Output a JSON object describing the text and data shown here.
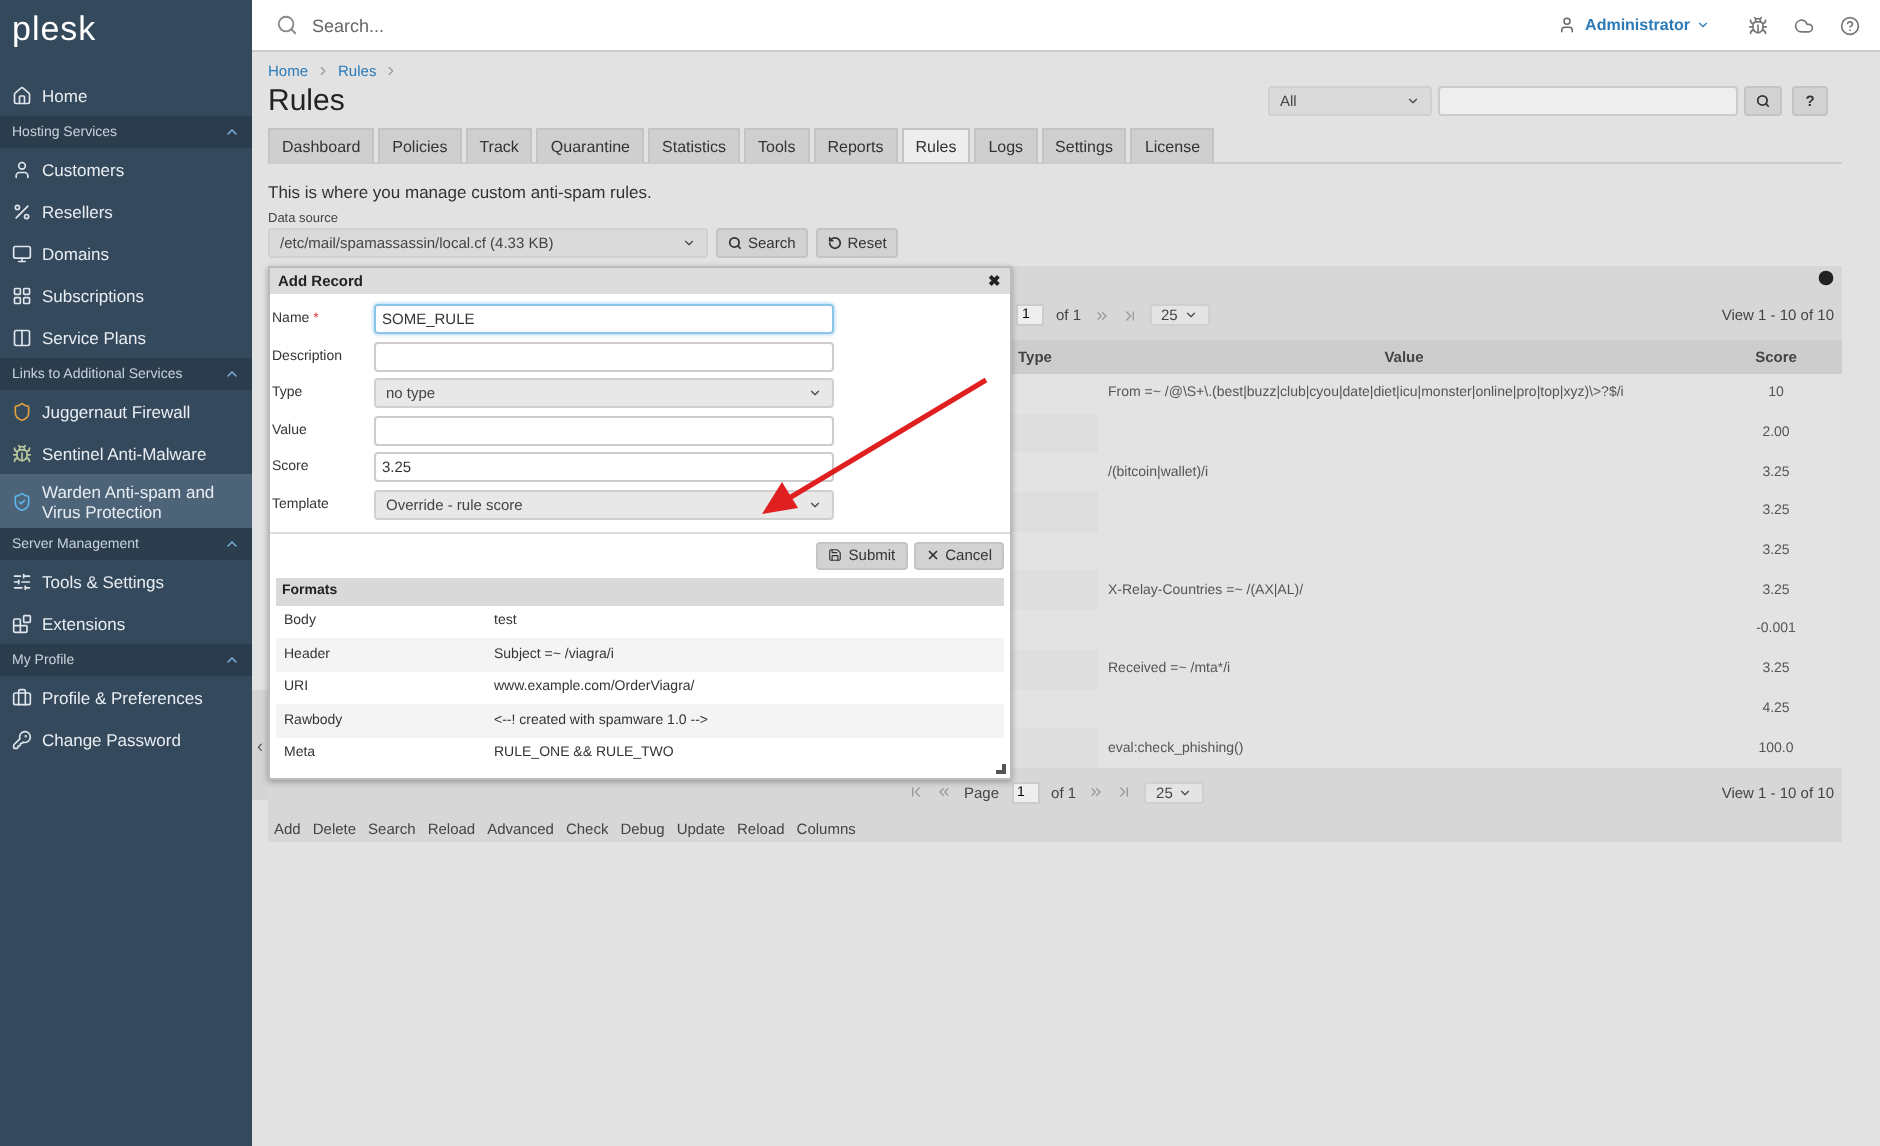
{
  "sidebar": {
    "logo": "plesk",
    "items": [
      {
        "kind": "item",
        "label": "Home",
        "selected": false
      },
      {
        "kind": "section",
        "label": "Hosting Services",
        "expanded": true
      },
      {
        "kind": "item",
        "label": "Customers",
        "selected": false
      },
      {
        "kind": "item",
        "label": "Resellers",
        "selected": false
      },
      {
        "kind": "item",
        "label": "Domains",
        "selected": false
      },
      {
        "kind": "item",
        "label": "Subscriptions",
        "selected": false
      },
      {
        "kind": "item",
        "label": "Service Plans",
        "selected": false
      },
      {
        "kind": "section",
        "label": "Links to Additional Services",
        "expanded": true
      },
      {
        "kind": "item",
        "label": "Juggernaut Firewall",
        "selected": false
      },
      {
        "kind": "item",
        "label": "Sentinel Anti-Malware",
        "selected": false
      },
      {
        "kind": "item",
        "label": "Warden Anti-spam and Virus Protection",
        "selected": true
      },
      {
        "kind": "section",
        "label": "Server Management",
        "expanded": true
      },
      {
        "kind": "item",
        "label": "Tools & Settings",
        "selected": false
      },
      {
        "kind": "item",
        "label": "Extensions",
        "selected": false
      },
      {
        "kind": "section",
        "label": "My Profile",
        "expanded": true
      },
      {
        "kind": "item",
        "label": "Profile & Preferences",
        "selected": false
      },
      {
        "kind": "item",
        "label": "Change Password",
        "selected": false
      }
    ],
    "collapse": "‹"
  },
  "topbar": {
    "search": {
      "placeholder": "Search..."
    },
    "user": "Administrator"
  },
  "breadcrumbs": [
    "Home",
    "Rules"
  ],
  "title": "Rules",
  "filter": {
    "scope": "All",
    "help": "?"
  },
  "tabs": [
    {
      "label": "Dashboard",
      "selected": false
    },
    {
      "label": "Policies",
      "selected": false
    },
    {
      "label": "Track",
      "selected": false
    },
    {
      "label": "Quarantine",
      "selected": false
    },
    {
      "label": "Statistics",
      "selected": false
    },
    {
      "label": "Tools",
      "selected": false
    },
    {
      "label": "Reports",
      "selected": false
    },
    {
      "label": "Rules",
      "selected": true
    },
    {
      "label": "Logs",
      "selected": false
    },
    {
      "label": "Settings",
      "selected": false
    },
    {
      "label": "License",
      "selected": false
    }
  ],
  "description": "This is where you manage custom anti-spam rules.",
  "data_source": {
    "label": "Data source",
    "value": "/etc/mail/spamassassin/local.cf (4.33 KB)",
    "buttons": [
      "Search",
      "Reset"
    ]
  },
  "grid": {
    "pager_top": {
      "page": "1",
      "of": "of 1",
      "page_size": "25",
      "view": "View 1 - 10 of 10"
    },
    "columns": [
      "Type",
      "Value",
      "Score"
    ],
    "rows": [
      {
        "value": "From =~ /@\\S+\\.(best|buzz|club|cyou|date|diet|icu|monster|online|pro|top|xyz)\\>?$/i",
        "score": "10"
      },
      {
        "score": "2.00"
      },
      {
        "value": "/(bitcoin|wallet)/i",
        "score": "3.25"
      },
      {
        "score": "3.25"
      },
      {
        "score": "3.25"
      },
      {
        "value": "X-Relay-Countries =~ /(AX|AL)/",
        "score": "3.25"
      },
      {
        "score": "-0.001"
      },
      {
        "value": "Received =~ /mta*/i",
        "score": "3.25"
      },
      {
        "score": "4.25"
      },
      {
        "value": "eval:check_phishing()",
        "score": "100.0"
      }
    ],
    "pager_bottom": {
      "page_label": "Page",
      "page": "1",
      "of": "of 1",
      "page_size": "25",
      "view": "View 1 - 10 of 10"
    },
    "actions": [
      "Add",
      "Delete",
      "Search",
      "Reload",
      "Advanced",
      "Check",
      "Debug",
      "Update",
      "Reload",
      "Columns"
    ]
  },
  "dialog": {
    "title": "Add Record",
    "close": "✖",
    "fields": [
      {
        "kind": "input",
        "label": "Name",
        "required_mark": "*",
        "value": "SOME_RULE",
        "focused": true
      },
      {
        "kind": "input",
        "label": "Description",
        "focused": false
      },
      {
        "kind": "select",
        "label": "Type",
        "value": "no type"
      },
      {
        "kind": "input",
        "label": "Value",
        "focused": false
      },
      {
        "kind": "input",
        "label": "Score",
        "value": "3.25",
        "focused": false
      },
      {
        "kind": "select",
        "label": "Template",
        "value": "Override - rule score"
      }
    ],
    "buttons": [
      "Submit",
      "Cancel"
    ],
    "formats": {
      "title": "Formats",
      "rows": [
        {
          "name": "Body",
          "example": "test"
        },
        {
          "name": "Header",
          "example": "Subject =~ /viagra/i"
        },
        {
          "name": "URI",
          "example": "www.example.com/OrderViagra/"
        },
        {
          "name": "Rawbody",
          "example": "<--! created with spamware 1.0 -->"
        },
        {
          "name": "Meta",
          "example": "RULE_ONE && RULE_TWO"
        }
      ]
    }
  }
}
